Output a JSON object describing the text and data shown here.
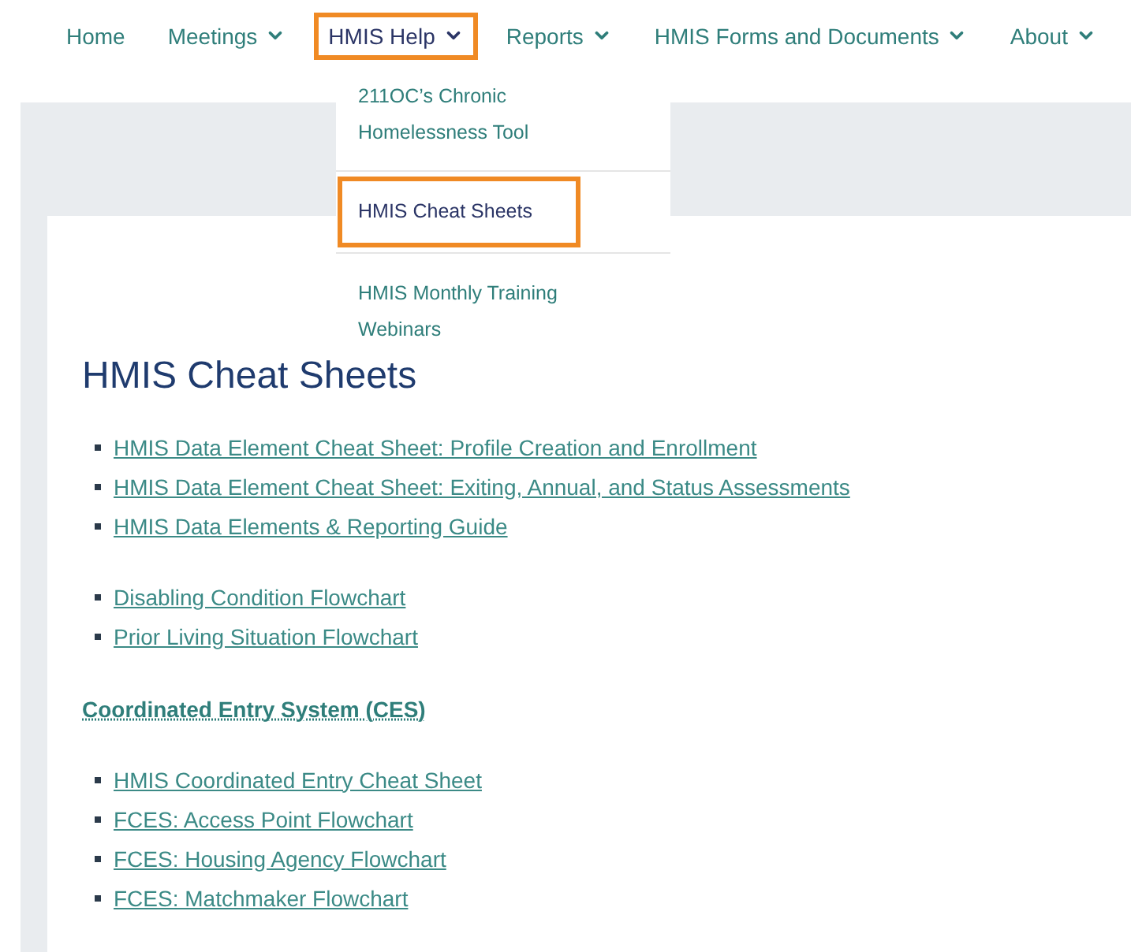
{
  "nav": {
    "items": [
      {
        "label": "Home",
        "has_menu": false,
        "selected": false,
        "highlighted": false
      },
      {
        "label": "Meetings",
        "has_menu": true,
        "selected": false,
        "highlighted": false
      },
      {
        "label": "HMIS Help",
        "has_menu": true,
        "selected": true,
        "highlighted": true
      },
      {
        "label": "Reports",
        "has_menu": true,
        "selected": false,
        "highlighted": false
      },
      {
        "label": "HMIS Forms and Documents",
        "has_menu": true,
        "selected": false,
        "highlighted": false
      },
      {
        "label": "About",
        "has_menu": true,
        "selected": false,
        "highlighted": false
      }
    ]
  },
  "dropdown": {
    "items": [
      {
        "label": "211OC’s Chronic Homelessness Tool",
        "selected": false,
        "highlighted": false
      },
      {
        "label": "HMIS Cheat Sheets",
        "selected": true,
        "highlighted": true
      },
      {
        "label": "HMIS Monthly Training Webinars",
        "selected": false,
        "highlighted": false
      }
    ]
  },
  "page": {
    "title": "HMIS Cheat Sheets",
    "sections": [
      {
        "links": [
          "HMIS Data Element Cheat Sheet: Profile Creation and Enrollment",
          "HMIS Data Element Cheat Sheet: Exiting, Annual, and Status Assessments",
          "HMIS Data Elements & Reporting Guide"
        ]
      },
      {
        "links": [
          "Disabling Condition Flowchart",
          "Prior Living Situation Flowchart"
        ]
      },
      {
        "heading": "Coordinated Entry System (CES)",
        "links": [
          "HMIS Coordinated Entry Cheat Sheet",
          "FCES: Access Point Flowchart",
          "FCES: Housing Agency Flowchart",
          "FCES: Matchmaker Flowchart"
        ]
      }
    ]
  }
}
